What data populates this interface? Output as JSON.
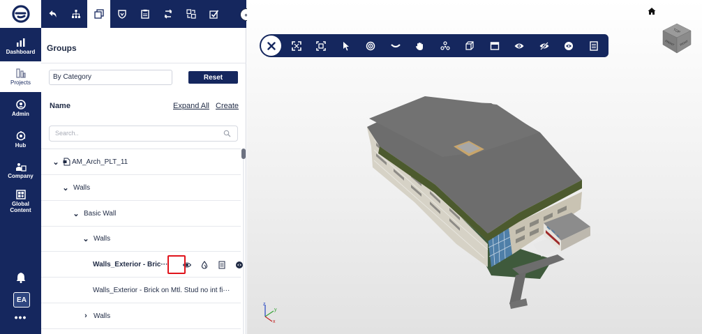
{
  "rail": {
    "items": [
      {
        "label": "Dashboard",
        "icon": "dashboard-icon",
        "active": false
      },
      {
        "label": "Projects",
        "icon": "projects-icon",
        "active": true
      },
      {
        "label": "Admin",
        "icon": "admin-icon",
        "active": false
      },
      {
        "label": "Hub",
        "icon": "hub-icon",
        "active": false
      },
      {
        "label": "Company",
        "icon": "company-icon",
        "active": false
      },
      {
        "label": "Global Content",
        "icon": "global-content-icon",
        "active": false
      }
    ],
    "avatar": "EA",
    "more": "•••"
  },
  "toolbar": {
    "icons": [
      "back-arrow-icon",
      "hierarchy-icon",
      "groups-icon",
      "shield-icon",
      "clipboard-icon",
      "sync-icon",
      "layers-icon",
      "checklist-icon"
    ],
    "active_index": 2
  },
  "panel": {
    "title": "Groups",
    "category_value": "By Category",
    "reset_label": "Reset",
    "name_header": "Name",
    "expand_all": "Expand All",
    "create": "Create",
    "search_placeholder": "Search..",
    "tree": [
      {
        "label": "AM_Arch_PLT_11",
        "chevron": "down",
        "has_file_icon": true
      },
      {
        "label": "Walls",
        "chevron": "down"
      },
      {
        "label": "Basic Wall",
        "chevron": "down"
      },
      {
        "label": "Walls",
        "chevron": "down"
      },
      {
        "label": "Walls_Exterior - Bric···",
        "bold": true,
        "chevron": ""
      },
      {
        "label": "Walls_Exterior - Brick on Mtl. Stud no int fi···",
        "chevron": ""
      },
      {
        "label": "Walls",
        "chevron": "right"
      }
    ]
  },
  "viewer": {
    "tools": [
      "fit-view-icon",
      "focus-icon",
      "select-cursor-icon",
      "orbit-icon",
      "look-icon",
      "pan-hand-icon",
      "explode-icon",
      "section-box-icon",
      "section-plane-icon",
      "show-icon",
      "hide-icon",
      "isolate-icon",
      "properties-icon"
    ],
    "cube_top": "TOP",
    "cube_side_a": "FRONT",
    "cube_side_b": "RIGHT",
    "triad_x": "x",
    "triad_y": "y",
    "triad_z": "z"
  },
  "colors": {
    "navy": "#15275e",
    "highlight": "#e0141c"
  }
}
